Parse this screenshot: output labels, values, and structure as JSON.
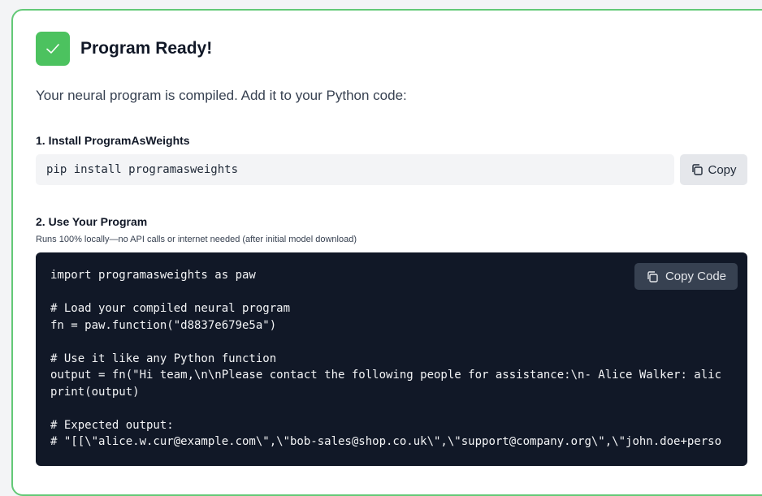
{
  "header": {
    "title": "Program Ready!",
    "icon": "check-icon"
  },
  "intro": "Your neural program is compiled. Add it to your Python code:",
  "step1": {
    "label": "1. Install ProgramAsWeights",
    "command": "pip install programasweights",
    "copy_label": "Copy"
  },
  "step2": {
    "label": "2. Use Your Program",
    "note": "Runs 100% locally—no API calls or internet needed (after initial model download)",
    "copy_label": "Copy Code",
    "code_lines": [
      "import programasweights as paw",
      "",
      "# Load your compiled neural program",
      "fn = paw.function(\"d8837e679e5a\")",
      "",
      "# Use it like any Python function",
      "output = fn(\"Hi team,\\n\\nPlease contact the following people for assistance:\\n- Alice Walker: alic",
      "print(output)",
      "",
      "# Expected output:",
      "# \"[[\\\"alice.w.cur@example.com\\\",\\\"bob-sales@shop.co.uk\\\",\\\"support@company.org\\\",\\\"john.doe+perso"
    ]
  },
  "colors": {
    "accent_green": "#4cc25f",
    "card_border": "#63c977",
    "code_bg": "#111827"
  }
}
